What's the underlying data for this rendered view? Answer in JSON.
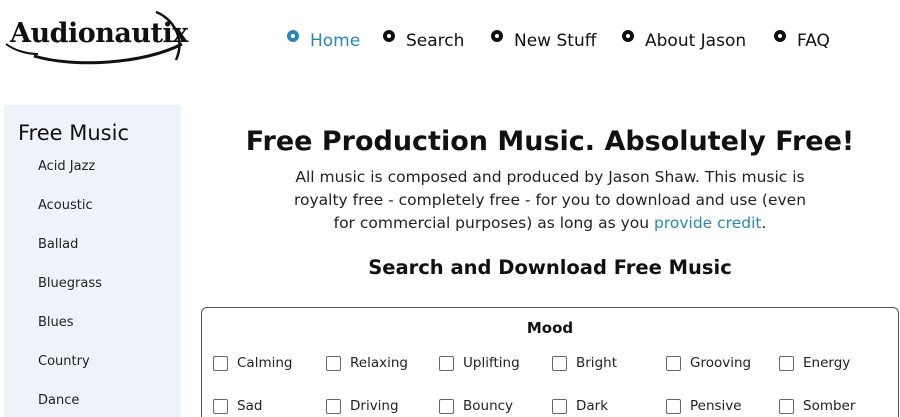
{
  "logo": {
    "text": "Audionautix"
  },
  "nav": {
    "items": [
      {
        "label": "Home",
        "active": true
      },
      {
        "label": "Search",
        "active": false
      },
      {
        "label": "New Stuff",
        "active": false
      },
      {
        "label": "About Jason",
        "active": false
      },
      {
        "label": "FAQ",
        "active": false
      }
    ]
  },
  "sidebar": {
    "title": "Free Music",
    "items": [
      "Acid Jazz",
      "Acoustic",
      "Ballad",
      "Bluegrass",
      "Blues",
      "Country",
      "Dance"
    ]
  },
  "main": {
    "title": "Free Production Music. Absolutely Free!",
    "intro_text": "All music is composed and produced by Jason Shaw. This music is royalty free - completely free - for you to download and use (even for commercial purposes) as long as you",
    "intro_link": "provide credit",
    "intro_end": ".",
    "section_title": "Search and Download Free Music"
  },
  "mood": {
    "title": "Mood",
    "options": [
      "Calming",
      "Relaxing",
      "Uplifting",
      "Bright",
      "Grooving",
      "Energy",
      "Sad",
      "Driving",
      "Bouncy",
      "Dark",
      "Pensive",
      "Somber"
    ]
  },
  "colors": {
    "accent": "#2a86b5",
    "sidebar_bg": "#eef3f9"
  }
}
